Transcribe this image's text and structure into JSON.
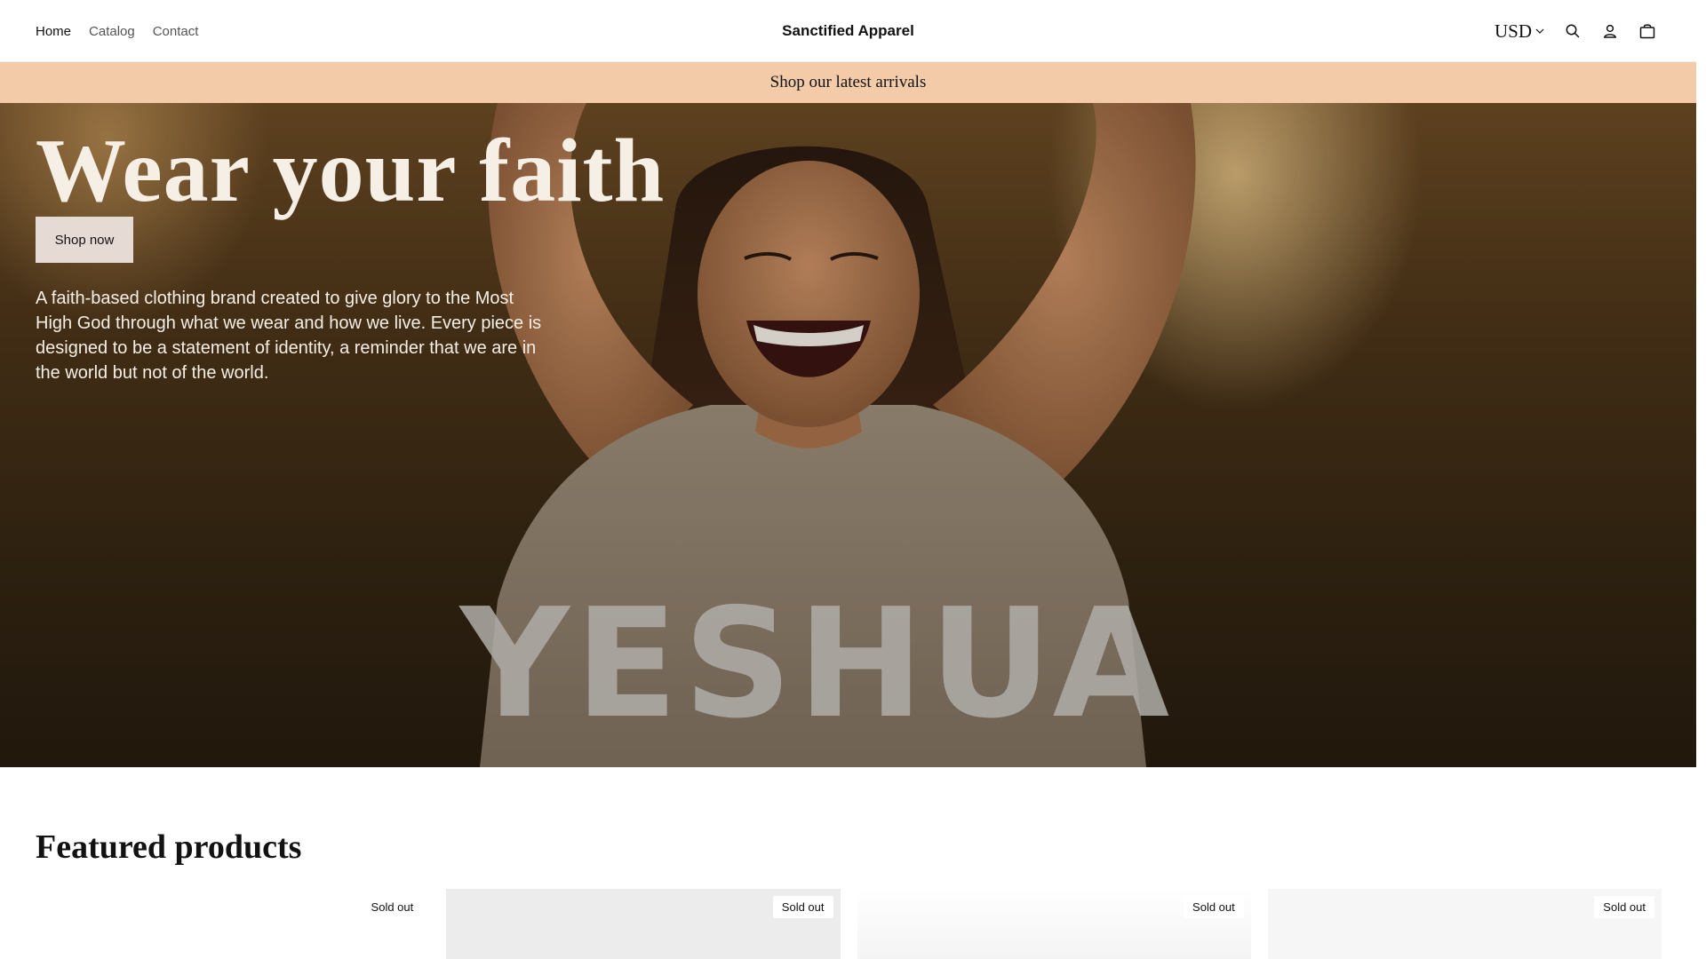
{
  "header": {
    "nav": [
      {
        "label": "Home"
      },
      {
        "label": "Catalog"
      },
      {
        "label": "Contact"
      }
    ],
    "brand": "Sanctified Apparel",
    "currency": "USD",
    "icons": [
      "search-icon",
      "account-icon",
      "cart-icon"
    ]
  },
  "announcement": "Shop our latest arrivals",
  "hero": {
    "title": "Wear your faith",
    "button": "Shop now",
    "description": "A faith-based clothing brand created to give glory to the Most High God through what we wear and how we live. Every piece is designed to be a statement of identity, a reminder that we are in the world but not of the world.",
    "shirt_text": "YESHUA"
  },
  "featured": {
    "title": "Featured products",
    "products": [
      {
        "badge": "Sold out"
      },
      {
        "badge": "Sold out"
      },
      {
        "badge": "Sold out"
      },
      {
        "badge": "Sold out"
      }
    ]
  },
  "colors": {
    "announcement_bg": "#f3cba8",
    "button_bg": "#e6dad4",
    "text": "#121212"
  }
}
